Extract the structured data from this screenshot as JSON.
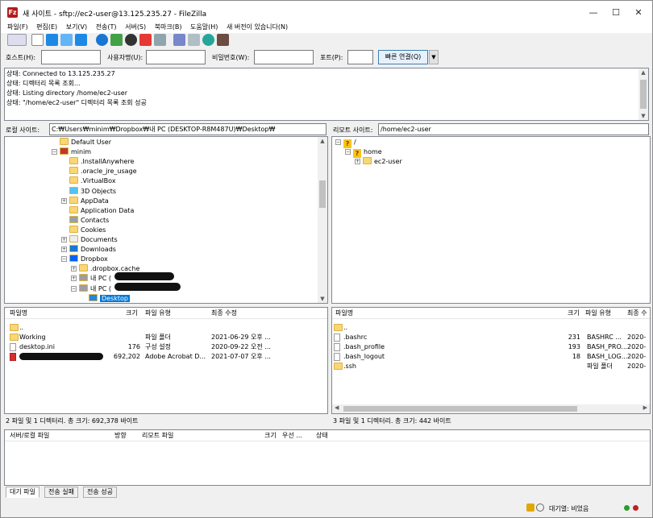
{
  "window": {
    "title": "새 사이트 - sftp://ec2-user@13.125.235.27 - FileZilla",
    "app_icon_letter": "Fz",
    "minimize": "—",
    "maximize": "☐",
    "close": "✕"
  },
  "menu": [
    "파일(F)",
    "편집(E)",
    "보기(V)",
    "전송(T)",
    "서버(S)",
    "북마크(B)",
    "도움말(H)",
    "새 버전이 있습니다(N)"
  ],
  "quickconnect": {
    "host_label": "호스트(H):",
    "host_value": "",
    "user_label": "사용자명(U):",
    "user_value": "",
    "pass_label": "비밀번호(W):",
    "pass_value": "",
    "port_label": "포트(P):",
    "port_value": "",
    "connect_button": "빠른 연결(Q)",
    "dropdown": "▼"
  },
  "log": [
    "상태: Connected to 13.125.235.27",
    "상태: 디렉터리 목록 조회...",
    "상태: Listing directory /home/ec2-user",
    "상태: \"/home/ec2-user\" 디렉터리 목록 조회 성공"
  ],
  "local": {
    "label": "로컬 사이트:",
    "path": "C:₩Users₩minim₩Dropbox₩내 PC (DESKTOP-R8M487U)₩Desktop₩",
    "tree": [
      {
        "label": "Default User",
        "type": "folder",
        "indent": 0,
        "expander": ""
      },
      {
        "label": "minim",
        "type": "user",
        "indent": 0,
        "expander": "−"
      },
      {
        "label": ".InstallAnywhere",
        "type": "folder",
        "indent": 1,
        "expander": ""
      },
      {
        "label": ".oracle_jre_usage",
        "type": "folder",
        "indent": 1,
        "expander": ""
      },
      {
        "label": ".VirtualBox",
        "type": "folder",
        "indent": 1,
        "expander": ""
      },
      {
        "label": "3D Objects",
        "type": "cube",
        "indent": 1,
        "expander": ""
      },
      {
        "label": "AppData",
        "type": "folder",
        "indent": 1,
        "expander": "+"
      },
      {
        "label": "Application Data",
        "type": "folder",
        "indent": 1,
        "expander": ""
      },
      {
        "label": "Contacts",
        "type": "contacts",
        "indent": 1,
        "expander": ""
      },
      {
        "label": "Cookies",
        "type": "folder",
        "indent": 1,
        "expander": ""
      },
      {
        "label": "Documents",
        "type": "doc",
        "indent": 1,
        "expander": "+"
      },
      {
        "label": "Downloads",
        "type": "download",
        "indent": 1,
        "expander": "+"
      },
      {
        "label": "Dropbox",
        "type": "dropbox",
        "indent": 1,
        "expander": "−"
      },
      {
        "label": ".dropbox.cache",
        "type": "folder",
        "indent": 2,
        "expander": "+"
      },
      {
        "label": "내 PC (",
        "type": "pc",
        "indent": 2,
        "expander": "+"
      },
      {
        "label": "내 PC (",
        "type": "pc",
        "indent": 2,
        "expander": "−"
      },
      {
        "label": "Desktop",
        "type": "desktop",
        "indent": 3,
        "expander": "",
        "selected": true
      }
    ],
    "columns": [
      "파일명",
      "크기",
      "파일 유형",
      "최종 수정"
    ],
    "files": [
      {
        "name": "..",
        "size": "",
        "type": "",
        "modified": "",
        "icon": "folder"
      },
      {
        "name": "Working",
        "size": "",
        "type": "파일 폴더",
        "modified": "2021-06-29 오후 ...",
        "icon": "folder"
      },
      {
        "name": "desktop.ini",
        "size": "176",
        "type": "구성 설정",
        "modified": "2020-09-22 오전 ...",
        "icon": "file"
      },
      {
        "name": "",
        "size": "692,202",
        "type": "Adobe Acrobat D...",
        "modified": "2021-07-07 오후 ...",
        "icon": "pdf"
      }
    ],
    "status": "2 파일 및 1 디렉터리. 총 크기: 692,378 바이트"
  },
  "remote": {
    "label": "리모트 사이트:",
    "path": "/home/ec2-user",
    "tree": [
      {
        "label": "/",
        "indent": 0,
        "expander": "−",
        "type": "q"
      },
      {
        "label": "home",
        "indent": 1,
        "expander": "−",
        "type": "q"
      },
      {
        "label": "ec2-user",
        "indent": 2,
        "expander": "+",
        "type": "folder"
      }
    ],
    "columns": [
      "파일명",
      "크기",
      "파일 유형",
      "최종 수"
    ],
    "files": [
      {
        "name": "..",
        "size": "",
        "type": "",
        "modified": "",
        "icon": "folder"
      },
      {
        "name": ".bashrc",
        "size": "231",
        "type": "BASHRC ...",
        "modified": "2020-",
        "icon": "file"
      },
      {
        "name": ".bash_profile",
        "size": "193",
        "type": "BASH_PRO...",
        "modified": "2020-",
        "icon": "file"
      },
      {
        "name": ".bash_logout",
        "size": "18",
        "type": "BASH_LOG...",
        "modified": "2020-",
        "icon": "file"
      },
      {
        "name": ".ssh",
        "size": "",
        "type": "파일 폴더",
        "modified": "2020-",
        "icon": "folder"
      }
    ],
    "status": "3 파일 및 1 디렉터리. 총 크기: 442 바이트"
  },
  "queue": {
    "columns": [
      "서버/로컬 파일",
      "방향",
      "리모트 파일",
      "크기",
      "우선 ...",
      "상태"
    ],
    "tabs": [
      "대기 파일",
      "전송 실패",
      "전송 성공"
    ]
  },
  "statusbar": {
    "queue_text": "대기열: 비었음"
  },
  "colors": {
    "accent": "#0078d7",
    "folder": "#f8d775",
    "selection": "#0078d7",
    "green_led": "#2a9d2a",
    "red_led": "#c02020"
  }
}
